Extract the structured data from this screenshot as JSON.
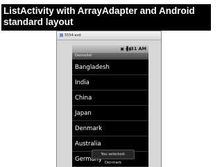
{
  "slide": {
    "title_line1": "ListActivity with ArrayAdapter and Android",
    "title_line2": "standard layout"
  },
  "window": {
    "title": "5554:avd"
  },
  "status_bar": {
    "time": "4:31 AM"
  },
  "app": {
    "title": "Demolist"
  },
  "list": {
    "items": [
      "Bangladesh",
      "India",
      "China",
      "Japan",
      "Denmark",
      "Australia",
      "Germany"
    ]
  },
  "toast": {
    "text": "You selected: Denmark"
  }
}
